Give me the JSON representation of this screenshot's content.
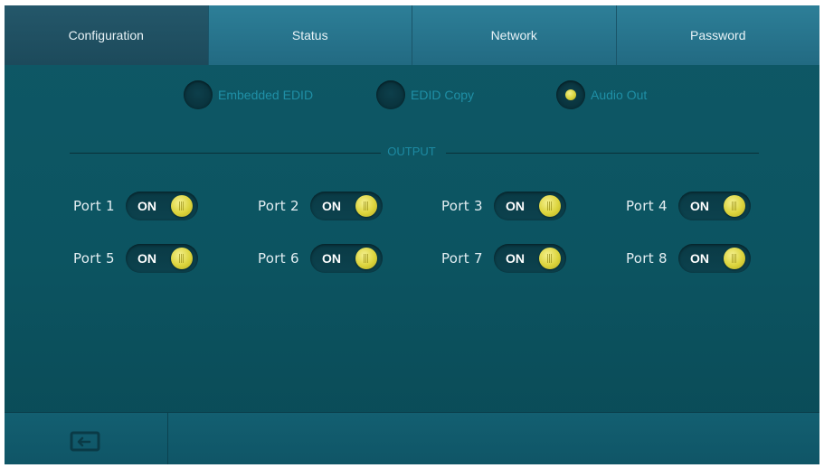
{
  "tabs": [
    {
      "label": "Configuration",
      "active": true
    },
    {
      "label": "Status",
      "active": false
    },
    {
      "label": "Network",
      "active": false
    },
    {
      "label": "Password",
      "active": false
    }
  ],
  "modes": [
    {
      "label": "Embedded EDID",
      "selected": false
    },
    {
      "label": "EDID Copy",
      "selected": false
    },
    {
      "label": "Audio Out",
      "selected": true
    }
  ],
  "output": {
    "title": "OUTPUT"
  },
  "ports": [
    {
      "label": "Port 1",
      "state": "ON"
    },
    {
      "label": "Port 2",
      "state": "ON"
    },
    {
      "label": "Port 3",
      "state": "ON"
    },
    {
      "label": "Port 4",
      "state": "ON"
    },
    {
      "label": "Port 5",
      "state": "ON"
    },
    {
      "label": "Port 6",
      "state": "ON"
    },
    {
      "label": "Port 7",
      "state": "ON"
    },
    {
      "label": "Port 8",
      "state": "ON"
    }
  ],
  "footer": {
    "back_icon": "return-icon"
  },
  "colors": {
    "accent_yellow": "#dcd43c",
    "teal_bg": "#0c5461",
    "tab_active": "#1c4a5b"
  }
}
